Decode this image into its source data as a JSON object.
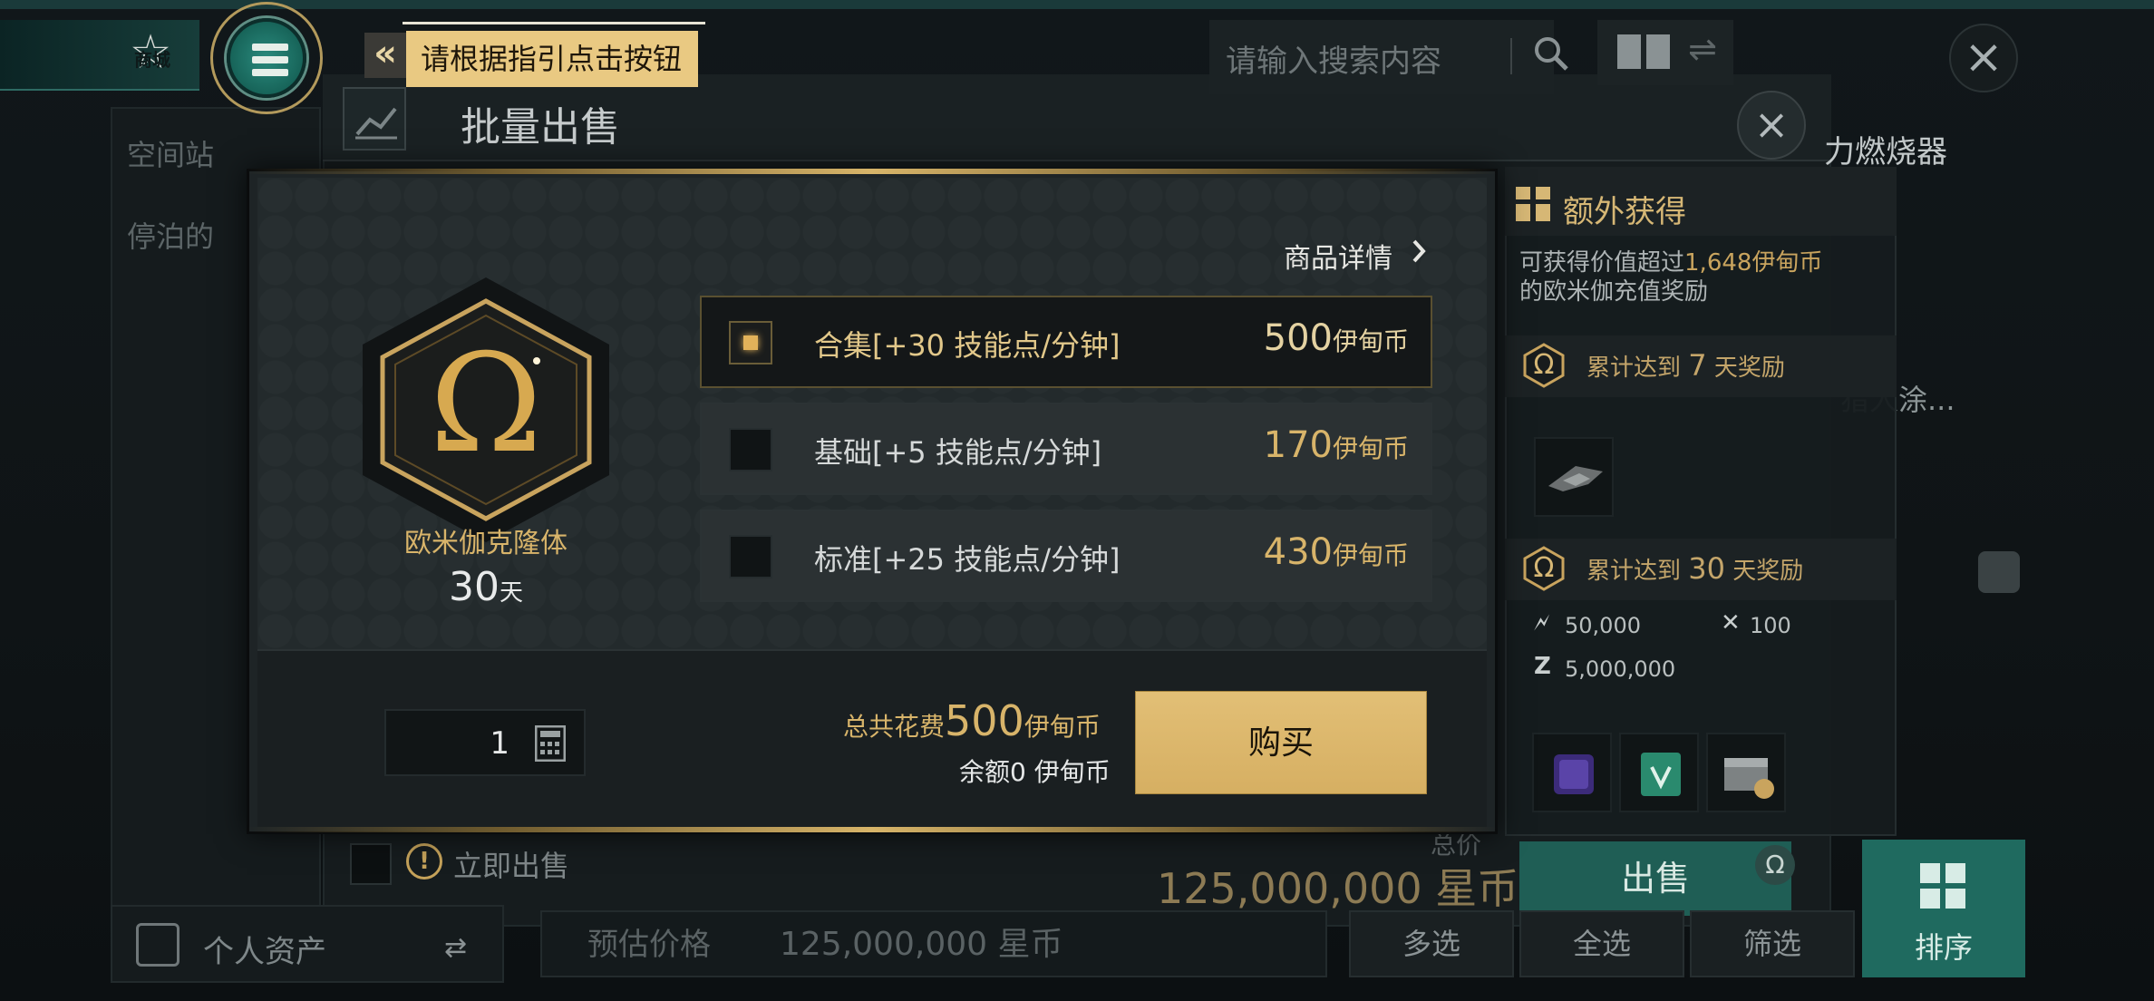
{
  "colors": {
    "accent_gold": "#d8b46a",
    "teal": "#1f6a5f",
    "panel": "#1e2426"
  },
  "top_bar": {
    "shop_label": "商城",
    "menu_icon": "menu-icon",
    "guide_text": "请根据指引点击按钮",
    "search_placeholder": "请输入搜索内容"
  },
  "background": {
    "panel_title": "批量出售",
    "side_items": [
      "空间站",
      "停泊的"
    ],
    "right_item_title": "力燃烧器",
    "right_item_sub": "猎人涂...",
    "personal_assets": "个人资产",
    "estimate_label": "预估价格",
    "estimate_value": "125,000,000 星币",
    "buttons": {
      "multi": "多选",
      "all": "全选",
      "filter": "筛选",
      "sort": "排序"
    },
    "sell_now": "立即出售",
    "total_label": "总价",
    "total_value": "125,000,000 星币",
    "sell_button": "出售"
  },
  "modal": {
    "detail_link": "商品详情",
    "clone": {
      "name": "欧米伽克隆体",
      "days": "30",
      "days_unit": "天"
    },
    "options": [
      {
        "label": "合集[+30 技能点/分钟]",
        "price": "500",
        "currency": "伊甸币",
        "selected": true
      },
      {
        "label": "基础[+5 技能点/分钟]",
        "price": "170",
        "currency": "伊甸币",
        "selected": false
      },
      {
        "label": "标准[+25 技能点/分钟]",
        "price": "430",
        "currency": "伊甸币",
        "selected": false
      }
    ],
    "quantity": "1",
    "total": {
      "label": "总共花费",
      "value": "500",
      "currency": "伊甸币"
    },
    "balance": "余额0 伊甸币",
    "buy_button": "购买"
  },
  "rewards": {
    "title": "额外获得",
    "desc_prefix": "可获得价值超过",
    "desc_value": "1,648伊甸币",
    "desc_suffix": "的欧米伽充值奖励",
    "tier1": {
      "prefix": "累计达到",
      "num": "7",
      "suffix": "天奖励"
    },
    "tier2": {
      "prefix": "累计达到",
      "num": "30",
      "suffix": "天奖励"
    },
    "resources": {
      "r1": "50,000",
      "r2": "100",
      "r3": "5,000,000"
    }
  }
}
